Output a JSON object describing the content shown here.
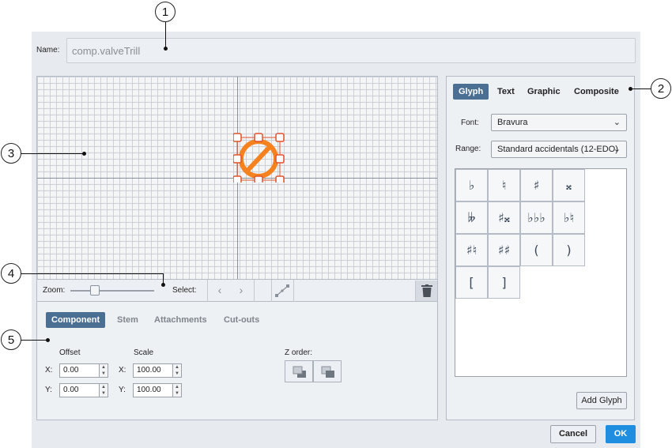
{
  "name_field": {
    "label": "Name:",
    "value": "comp.valveTrill"
  },
  "toolbar": {
    "zoom_label": "Zoom:",
    "zoom_level": 0.27,
    "select_label": "Select:",
    "prev_icon": "chevron-left-icon",
    "next_icon": "chevron-right-icon",
    "path_icon": "path-edit-icon",
    "delete_icon": "trash-icon"
  },
  "bottom_tabs": [
    "Component",
    "Stem",
    "Attachments",
    "Cut-outs"
  ],
  "offset": {
    "label": "Offset",
    "x_label": "X:",
    "x": "0.00",
    "y_label": "Y:",
    "y": "0.00"
  },
  "scale": {
    "label": "Scale",
    "x_label": "X:",
    "x": "100.00",
    "y_label": "Y:",
    "y": "100.00"
  },
  "z_order": {
    "label": "Z order:"
  },
  "right_tabs": [
    "Glyph",
    "Text",
    "Graphic",
    "Composite"
  ],
  "font": {
    "label": "Font:",
    "value": "Bravura"
  },
  "range": {
    "label": "Range:",
    "value": "Standard accidentals (12-EDO)"
  },
  "glyphs": [
    "♭",
    "♮",
    "♯",
    "𝄪",
    "𝄫",
    "♯𝄪",
    "♭♭♭",
    "♭♮",
    "♯♮",
    "♯♯",
    "(",
    ")",
    "[",
    "]"
  ],
  "add_glyph_button": "Add Glyph",
  "cancel_button": "Cancel",
  "ok_button": "OK",
  "callouts": [
    "1",
    "2",
    "3",
    "4",
    "5"
  ],
  "colors": {
    "accent": "#4a6f93",
    "ok": "#1f8ee0",
    "glyph_orange": "#f5821f",
    "handle": "#e0532b"
  }
}
